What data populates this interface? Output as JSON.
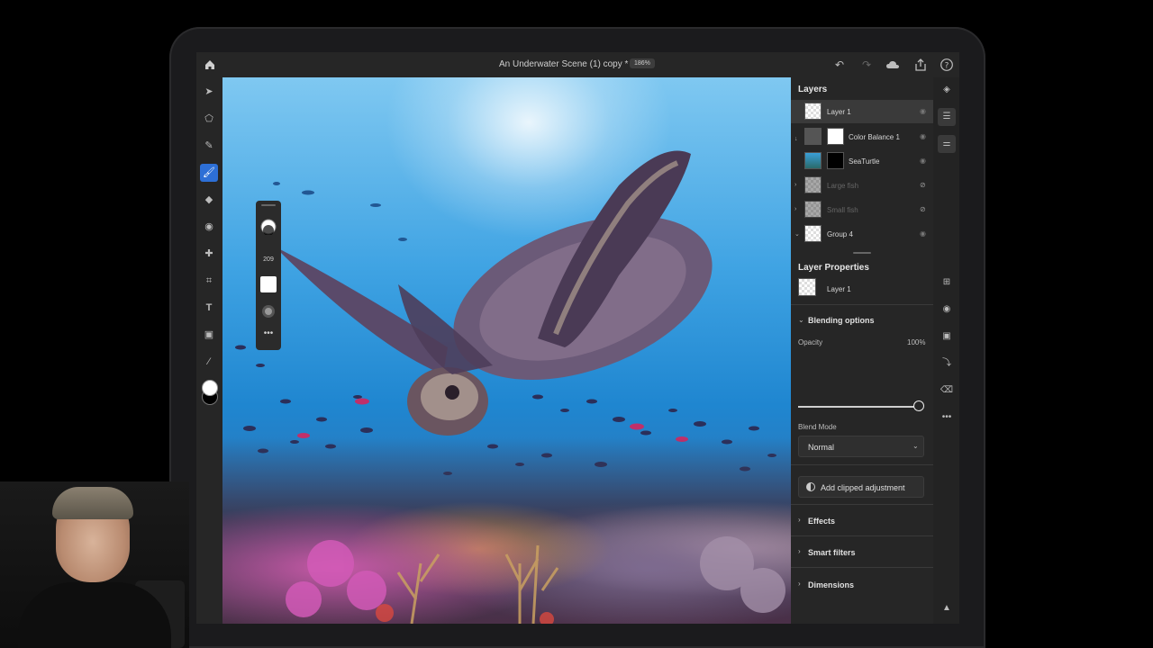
{
  "topbar": {
    "doc_title": "An Underwater Scene (1) copy *",
    "zoom": "186%"
  },
  "brush_panel": {
    "size": "209"
  },
  "layers": {
    "title": "Layers",
    "items": [
      {
        "name": "Layer 1",
        "selected": true,
        "thumb": "checker"
      },
      {
        "name": "Color Balance 1",
        "selected": false,
        "thumb": "adjustment"
      },
      {
        "name": "SeaTurtle",
        "selected": false,
        "thumb": "turtle"
      },
      {
        "name": "Large fish",
        "selected": false,
        "thumb": "checker",
        "hidden": true
      },
      {
        "name": "Small fish",
        "selected": false,
        "thumb": "checker",
        "hidden": true
      },
      {
        "name": "Group 4",
        "selected": false,
        "thumb": "checker"
      }
    ]
  },
  "layer_properties": {
    "title": "Layer Properties",
    "layer_name": "Layer 1",
    "blending_options": "Blending options",
    "opacity_label": "Opacity",
    "opacity_value": "100%",
    "blend_mode_label": "Blend Mode",
    "blend_mode_value": "Normal",
    "add_clipped": "Add clipped adjustment",
    "effects": "Effects",
    "smart_filters": "Smart filters",
    "dimensions": "Dimensions"
  },
  "colors": {
    "accent": "#2d6fd6",
    "panel_bg": "#262626"
  }
}
